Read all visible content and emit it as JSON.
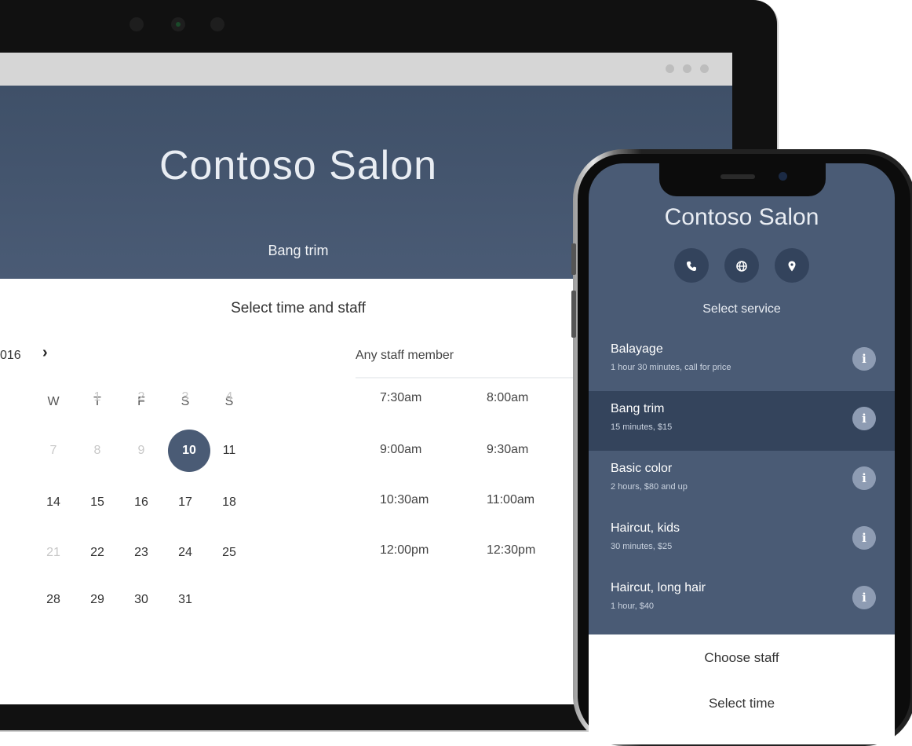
{
  "web": {
    "title": "Contoso Salon",
    "service": "Bang trim",
    "section_title": "Select time and staff",
    "month_year": "016",
    "next_glyph": "›",
    "staff_select": "Any staff member",
    "days_of_week": [
      "W",
      "T",
      "F",
      "S",
      "S"
    ],
    "calendar_rows": [
      [
        "",
        "1",
        "2",
        "3",
        "4"
      ],
      [
        "7",
        "8",
        "9",
        "10",
        "11"
      ],
      [
        "14",
        "15",
        "16",
        "17",
        "18"
      ],
      [
        "21",
        "22",
        "23",
        "24",
        "25"
      ],
      [
        "28",
        "29",
        "30",
        "31",
        ""
      ]
    ],
    "selected_day": "10",
    "time_slots": [
      [
        "7:30am",
        "8:00am"
      ],
      [
        "9:00am",
        "9:30am"
      ],
      [
        "10:30am",
        "11:00am"
      ],
      [
        "12:00pm",
        "12:30pm"
      ]
    ]
  },
  "mobile": {
    "title": "Contoso Salon",
    "icons": [
      "phone-icon",
      "globe-icon",
      "location-pin-icon"
    ],
    "select_label": "Select service",
    "services": [
      {
        "name": "Balayage",
        "desc": "1 hour 30 minutes, call for price"
      },
      {
        "name": "Bang trim",
        "desc": "15 minutes, $15"
      },
      {
        "name": "Basic color",
        "desc": "2 hours, $80 and up"
      },
      {
        "name": "Haircut, kids",
        "desc": "30 minutes, $25"
      },
      {
        "name": "Haircut, long hair",
        "desc": "1 hour, $40"
      }
    ],
    "selected_service": "Bang trim",
    "info_glyph": "i",
    "choose_staff": "Choose staff",
    "select_time": "Select time"
  },
  "colors": {
    "header": "#4a5b75",
    "selected_row": "#34445c",
    "accent": "#4a5b75"
  }
}
